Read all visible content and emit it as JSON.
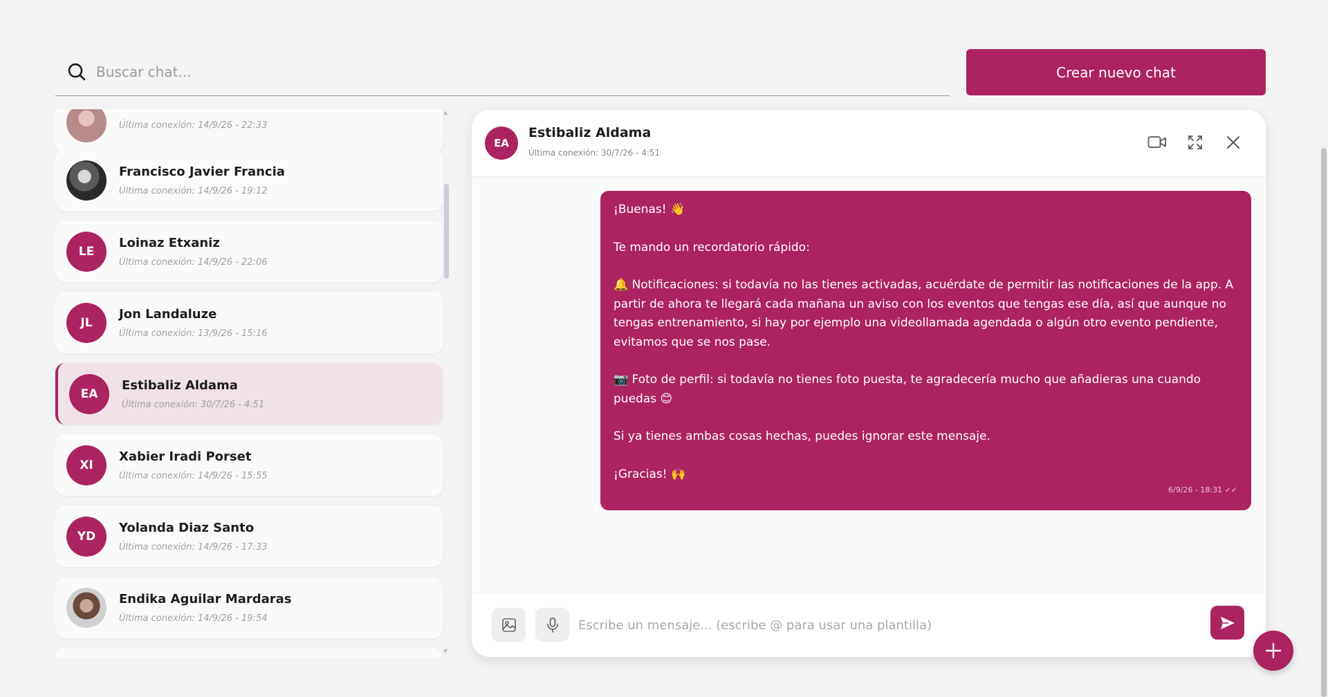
{
  "search": {
    "placeholder": "Buscar chat..."
  },
  "create_button": {
    "label": "Crear nuevo chat"
  },
  "chat_list": [
    {
      "name": "",
      "initials": "",
      "photo": true,
      "last_seen": "Última conexión: 14/9/26 - 22:33"
    },
    {
      "name": "Francisco Javier Francia",
      "initials": "",
      "photo": true,
      "last_seen": "Última conexión: 14/9/26 - 19:12"
    },
    {
      "name": "Loinaz Etxaniz",
      "initials": "LE",
      "last_seen": "Última conexión: 14/9/26 - 22:06"
    },
    {
      "name": "Jon Landaluze",
      "initials": "JL",
      "last_seen": "Última conexión: 13/9/26 - 15:16"
    },
    {
      "name": "Estibaliz Aldama",
      "initials": "EA",
      "active": true,
      "last_seen": "Última conexión: 30/7/26 - 4:51"
    },
    {
      "name": "Xabier Iradi Porset",
      "initials": "XI",
      "last_seen": "Última conexión: 14/9/26 - 15:55"
    },
    {
      "name": "Yolanda Diaz Santo",
      "initials": "YD",
      "last_seen": "Última conexión: 14/9/26 - 17:33"
    },
    {
      "name": "Endika Aguilar Mardaras",
      "initials": "",
      "photo": true,
      "last_seen": "Última conexión: 14/9/26 - 19:54"
    }
  ],
  "conversation": {
    "contact_initials": "EA",
    "contact_name": "Estibaliz Aldama",
    "contact_last_seen": "Última conexión: 30/7/26 - 4:51",
    "message": {
      "greeting": "¡Buenas! 👋",
      "intro": "Te mando un recordatorio rápido:",
      "notifications": "🔔 Notificaciones: si todavía no las tienes activadas, acuérdate de permitir las notificaciones de la app. A partir de ahora te llegará cada mañana un aviso con los eventos que tengas ese día, así que aunque no tengas entrenamiento, si hay por ejemplo una videollamada agendada o algún otro evento pendiente, evitamos que se nos pase.",
      "photo": "📷 Foto de perfil: si todavía no tienes foto puesta, te agradecería mucho que añadieras una cuando puedas 😊",
      "ignore": "Si ya tienes ambas cosas hechas, puedes ignorar este mensaje.",
      "thanks": "¡Gracias! 🙌",
      "timestamp": "6/9/26 - 18:31 ✓✓"
    }
  },
  "composer": {
    "placeholder": "Escribe un mensaje... (escribe @ para usar una plantilla)"
  },
  "colors": {
    "accent": "#ac2361",
    "background": "#f3f3f3"
  }
}
